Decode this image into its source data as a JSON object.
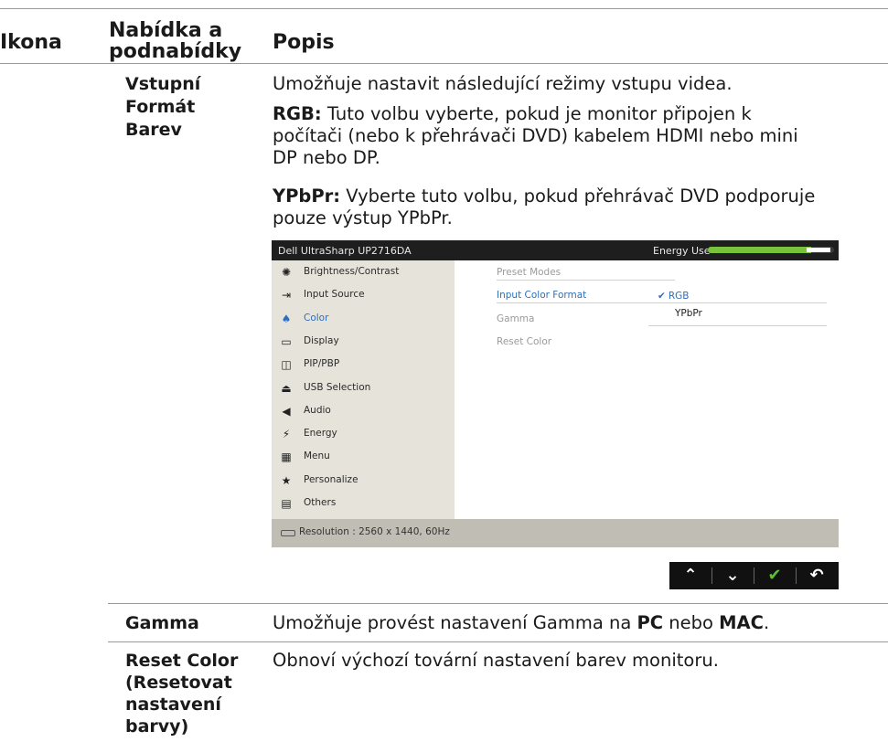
{
  "headers": {
    "icon": "Ikona",
    "menu_line1": "Nabídka a",
    "menu_line2": "podnabídky",
    "description": "Popis"
  },
  "rows": [
    {
      "menu_lines": [
        "Vstupní",
        "Formát",
        "Barev"
      ],
      "intro": "Umožňuje nastavit následující režimy vstupu videa.",
      "rgb_term": "RGB:",
      "rgb_lines": [
        " Tuto volbu vyberte, pokud je monitor připojen k",
        "počítači (nebo k přehrávači DVD) kabelem HDMI nebo mini",
        "DP nebo DP."
      ],
      "ypbpr_term": "YPbPr:",
      "ypbpr_lines": [
        " Vyberte tuto volbu, pokud přehrávač DVD podporuje",
        "pouze výstup YPbPr."
      ]
    },
    {
      "menu": "Gamma",
      "desc_prefix": "Umožňuje provést nastavení Gamma na ",
      "pc": "PC",
      "mid": " nebo ",
      "mac": "MAC",
      "end": "."
    },
    {
      "menu_lines": [
        "Reset Color",
        "(Resetovat",
        "nastavení",
        "barvy)"
      ],
      "desc": "Obnoví výchozí tovární nastavení barev monitoru."
    }
  ],
  "osd": {
    "title": "Dell UltraSharp UP2716DA",
    "energy_label": "Energy Use",
    "energy_level_percent": 82,
    "menu": [
      {
        "icon": "brightness-icon",
        "glyph": "✺",
        "label": "Brightness/Contrast",
        "selected": false
      },
      {
        "icon": "input-source-icon",
        "glyph": "⇥",
        "label": "Input Source",
        "selected": false
      },
      {
        "icon": "color-icon",
        "glyph": "♠",
        "label": "Color",
        "selected": true
      },
      {
        "icon": "display-icon",
        "glyph": "▭",
        "label": "Display",
        "selected": false
      },
      {
        "icon": "pip-pbp-icon",
        "glyph": "◫",
        "label": "PIP/PBP",
        "selected": false
      },
      {
        "icon": "usb-icon",
        "glyph": "⏏",
        "label": "USB Selection",
        "selected": false
      },
      {
        "icon": "audio-icon",
        "glyph": "◀",
        "label": "Audio",
        "selected": false
      },
      {
        "icon": "energy-icon",
        "glyph": "⚡",
        "label": "Energy",
        "selected": false
      },
      {
        "icon": "menu-icon",
        "glyph": "▦",
        "label": "Menu",
        "selected": false
      },
      {
        "icon": "star-icon",
        "glyph": "★",
        "label": "Personalize",
        "selected": false
      },
      {
        "icon": "others-icon",
        "glyph": "▤",
        "label": "Others",
        "selected": false
      }
    ],
    "submenu": [
      {
        "label": "Preset Modes",
        "selected": false
      },
      {
        "label": "Input Color Format",
        "selected": true
      },
      {
        "label": "Gamma",
        "selected": false
      },
      {
        "label": "Reset Color",
        "selected": false
      }
    ],
    "options": [
      {
        "label": "RGB",
        "checked": true
      },
      {
        "label": "YPbPr",
        "checked": false
      }
    ],
    "checkmark": "✔",
    "resolution": "Resolution : 2560 x 1440, 60Hz",
    "buttons": [
      {
        "icon": "up-arrow-icon",
        "glyph": "⌃"
      },
      {
        "icon": "down-arrow-icon",
        "glyph": "⌄"
      },
      {
        "icon": "check-icon",
        "glyph": "✔"
      },
      {
        "icon": "back-icon",
        "glyph": "↶"
      }
    ]
  }
}
